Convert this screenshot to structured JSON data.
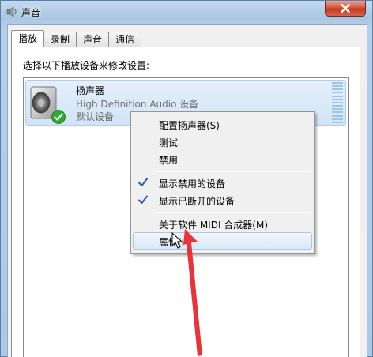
{
  "window": {
    "title": "声音",
    "close_icon": "close-icon"
  },
  "tabs": [
    {
      "label": "播放",
      "active": true
    },
    {
      "label": "录制",
      "active": false
    },
    {
      "label": "声音",
      "active": false
    },
    {
      "label": "通信",
      "active": false
    }
  ],
  "panel": {
    "instruction": "选择以下播放设备来修改设置:"
  },
  "device": {
    "name": "扬声器",
    "description": "High Definition Audio 设备",
    "status": "默认设备",
    "icon": "speaker-icon",
    "status_icon": "green-check-icon"
  },
  "context_menu": {
    "items": [
      {
        "label": "配置扬声器(S)",
        "checked": false
      },
      {
        "label": "测试",
        "checked": false
      },
      {
        "label": "禁用",
        "checked": false
      },
      {
        "label": "显示禁用的设备",
        "checked": true
      },
      {
        "label": "显示已断开的设备",
        "checked": true
      },
      {
        "label": "关于软件 MIDI 合成器(M)",
        "checked": false
      },
      {
        "label": "属性(P)",
        "checked": false,
        "highlighted": true
      }
    ]
  },
  "colors": {
    "accent": "#3399ff",
    "annotation_arrow": "#e8333a",
    "check_green": "#2fa82f"
  }
}
